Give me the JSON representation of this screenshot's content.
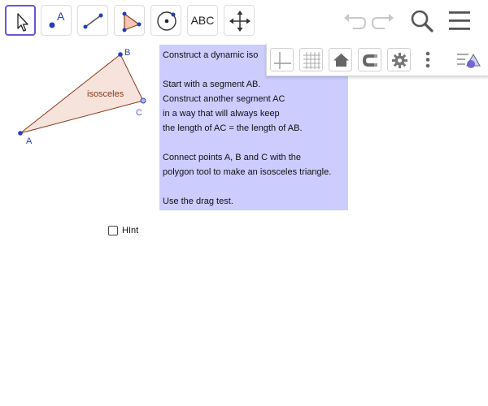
{
  "toolbar": {
    "tools": [
      {
        "name": "move-tool"
      },
      {
        "name": "point-tool",
        "label": "A"
      },
      {
        "name": "segment-tool"
      },
      {
        "name": "polygon-tool"
      },
      {
        "name": "circle-tool"
      },
      {
        "name": "text-tool",
        "label": "ABC"
      },
      {
        "name": "move-view-tool"
      }
    ]
  },
  "textbox": {
    "lines": [
      "Construct a dynamic iso",
      "",
      "Start with a segment AB.",
      "Construct another segment AC",
      "in a way that will always keep",
      "the length of AC = the length of AB.",
      "",
      "Connect points A, B and C with the",
      "polygon tool to make an isosceles triangle.",
      "",
      "Use the drag test."
    ]
  },
  "graphics": {
    "triangle_label": "isosceles",
    "points": {
      "A": "A",
      "B": "B",
      "C": "C"
    }
  },
  "hint": {
    "label": "HInt"
  },
  "colors": {
    "accent": "#6557d2",
    "textbox_bg": "#ccccff",
    "triangle_fill": "#f5e3dc",
    "triangle_stroke": "#8b3a1a",
    "point_blue": "#1f3fbf"
  }
}
